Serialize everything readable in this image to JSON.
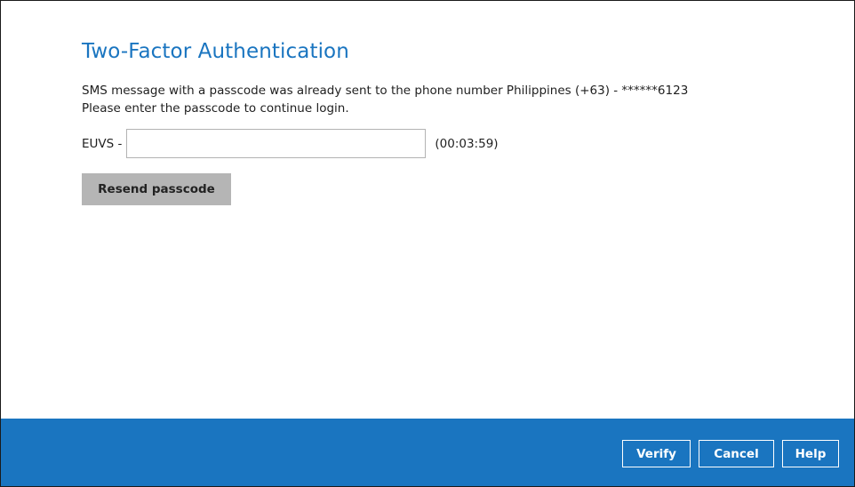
{
  "dialog": {
    "title": "Two-Factor Authentication",
    "message_line1": "SMS message with a passcode was already sent to the phone number Philippines (+63) - ******6123",
    "message_line2": "Please enter the passcode to continue login.",
    "code_prefix": "EUVS -",
    "passcode_value": "",
    "timer": "(00:03:59)",
    "resend_label": "Resend passcode"
  },
  "footer": {
    "verify_label": "Verify",
    "cancel_label": "Cancel",
    "help_label": "Help"
  },
  "colors": {
    "accent": "#1a75c0",
    "resend_bg": "#b5b5b5"
  }
}
